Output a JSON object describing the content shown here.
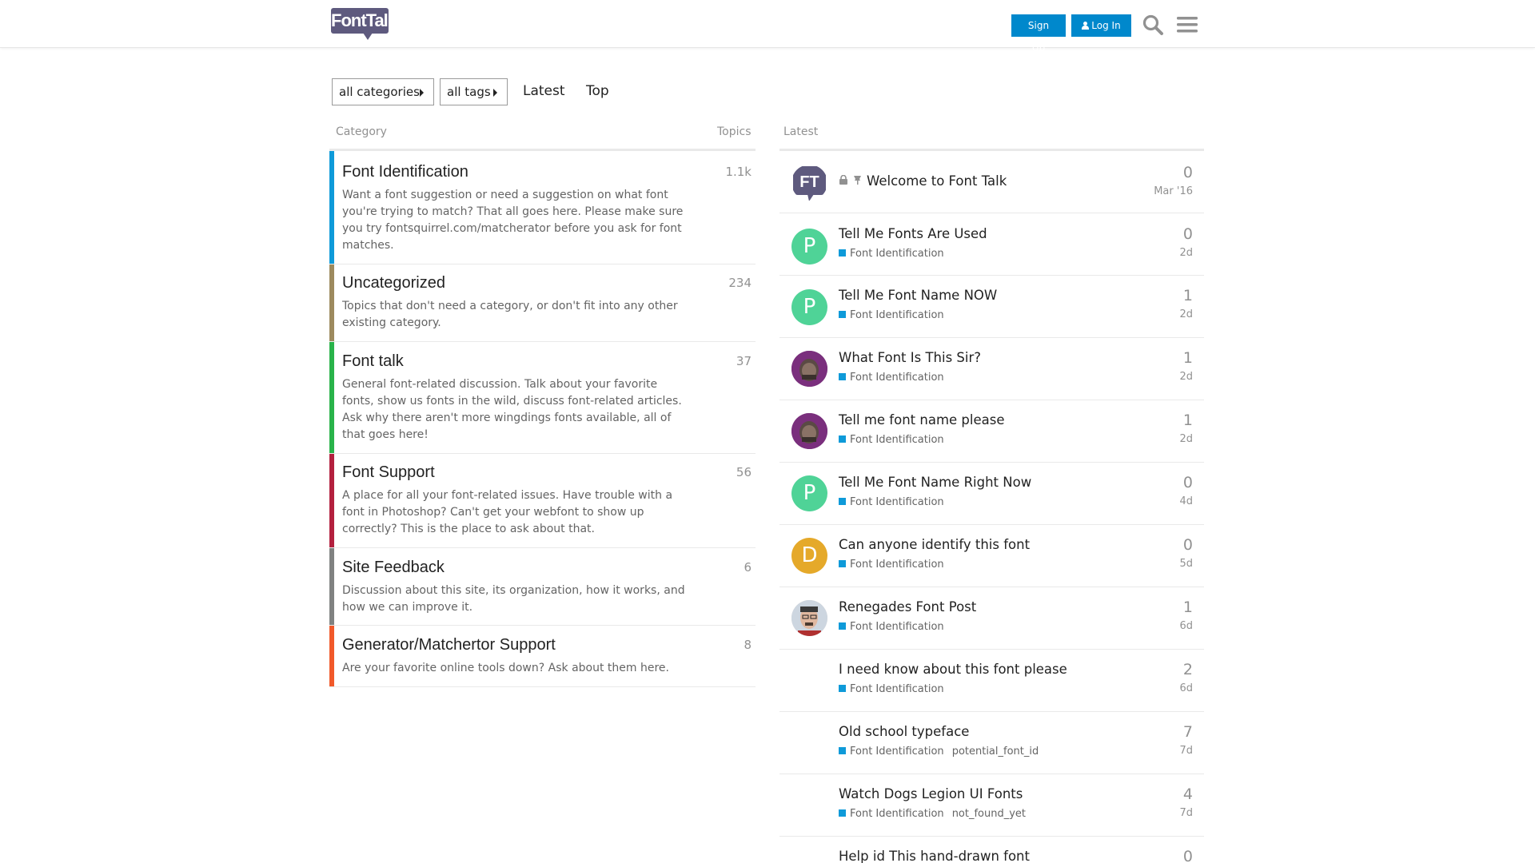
{
  "header": {
    "logo_text": "FontTalk",
    "signup_label": "Sign Up",
    "login_label": "Log In"
  },
  "nav": {
    "categories_dropdown": "all categories",
    "tags_dropdown": "all tags",
    "latest_link": "Latest",
    "top_link": "Top"
  },
  "table_headers": {
    "category": "Category",
    "topics": "Topics",
    "latest": "Latest"
  },
  "categories": [
    {
      "name": "Font Identification",
      "description": "Want a font suggestion or need a suggestion on what font you're trying to match? That all goes here. Please make sure you try fontsquirrel.com/matcherator before you ask for font matches.",
      "count": "1.1k",
      "color": "#0e9ad9"
    },
    {
      "name": "Uncategorized",
      "description": "Topics that don't need a category, or don't fit into any other existing category.",
      "count": "234",
      "color": "#9d8a5e"
    },
    {
      "name": "Font talk",
      "description": "General font-related discussion. Talk about your favorite fonts, show us fonts in the wild, discuss font-related articles. Ask why there aren't more wingdings fonts available, all of that goes here!",
      "count": "37",
      "color": "#29b34a"
    },
    {
      "name": "Font Support",
      "description": "A place for all your font-related issues. Have trouble with a font in Photoshop? Can't get your webfont to show up correctly? This is the place to ask about that.",
      "count": "56",
      "color": "#b3203e"
    },
    {
      "name": "Site Feedback",
      "description": "Discussion about this site, its organization, how it works, and how we can improve it.",
      "count": "6",
      "color": "#808281"
    },
    {
      "name": "Generator/Matchertor Support",
      "description": "Are your favorite online tools down? Ask about them here.",
      "count": "8",
      "color": "#f1592a"
    }
  ],
  "latest_topics": [
    {
      "title": "Welcome to Font Talk",
      "category": "",
      "tags": [],
      "replies": "0",
      "age": "Mar '16",
      "avatar": "FT",
      "avatar_color": "#5e5a7e",
      "pinned": true
    },
    {
      "title": "Tell Me Fonts Are Used",
      "category": "Font Identification",
      "tags": [],
      "replies": "0",
      "age": "2d",
      "avatar": "P",
      "avatar_color": "#4fd397"
    },
    {
      "title": "Tell Me Font Name NOW",
      "category": "Font Identification",
      "tags": [],
      "replies": "1",
      "age": "2d",
      "avatar": "P",
      "avatar_color": "#4fd397"
    },
    {
      "title": "What Font Is This Sir?",
      "category": "Font Identification",
      "tags": [],
      "replies": "1",
      "age": "2d",
      "avatar": "",
      "avatar_color": "#6b2a6e"
    },
    {
      "title": "Tell me font name please",
      "category": "Font Identification",
      "tags": [],
      "replies": "1",
      "age": "2d",
      "avatar": "",
      "avatar_color": "#6b2a6e"
    },
    {
      "title": "Tell Me Font Name Right Now",
      "category": "Font Identification",
      "tags": [],
      "replies": "0",
      "age": "4d",
      "avatar": "P",
      "avatar_color": "#4fd397"
    },
    {
      "title": "Can anyone identify this font",
      "category": "Font Identification",
      "tags": [],
      "replies": "0",
      "age": "5d",
      "avatar": "D",
      "avatar_color": "#e5a92a"
    },
    {
      "title": "Renegades Font Post",
      "category": "Font Identification",
      "tags": [],
      "replies": "1",
      "age": "6d",
      "avatar": "",
      "avatar_color": "#c9b8a6"
    },
    {
      "title": "I need know about this font please",
      "category": "Font Identification",
      "tags": [],
      "replies": "2",
      "age": "6d",
      "avatar": "",
      "avatar_color": "#ffffff"
    },
    {
      "title": "Old school typeface",
      "category": "Font Identification",
      "tags": [
        "potential_font_id"
      ],
      "replies": "7",
      "age": "7d",
      "avatar": "",
      "avatar_color": "#ffffff"
    },
    {
      "title": "Watch Dogs Legion UI Fonts",
      "category": "Font Identification",
      "tags": [
        "not_found_yet"
      ],
      "replies": "4",
      "age": "7d",
      "avatar": "",
      "avatar_color": "#ffffff"
    },
    {
      "title": "Help id This hand-drawn font",
      "category": "",
      "tags": [],
      "replies": "0",
      "age": "",
      "avatar": "",
      "avatar_color": "#ffffff"
    }
  ]
}
